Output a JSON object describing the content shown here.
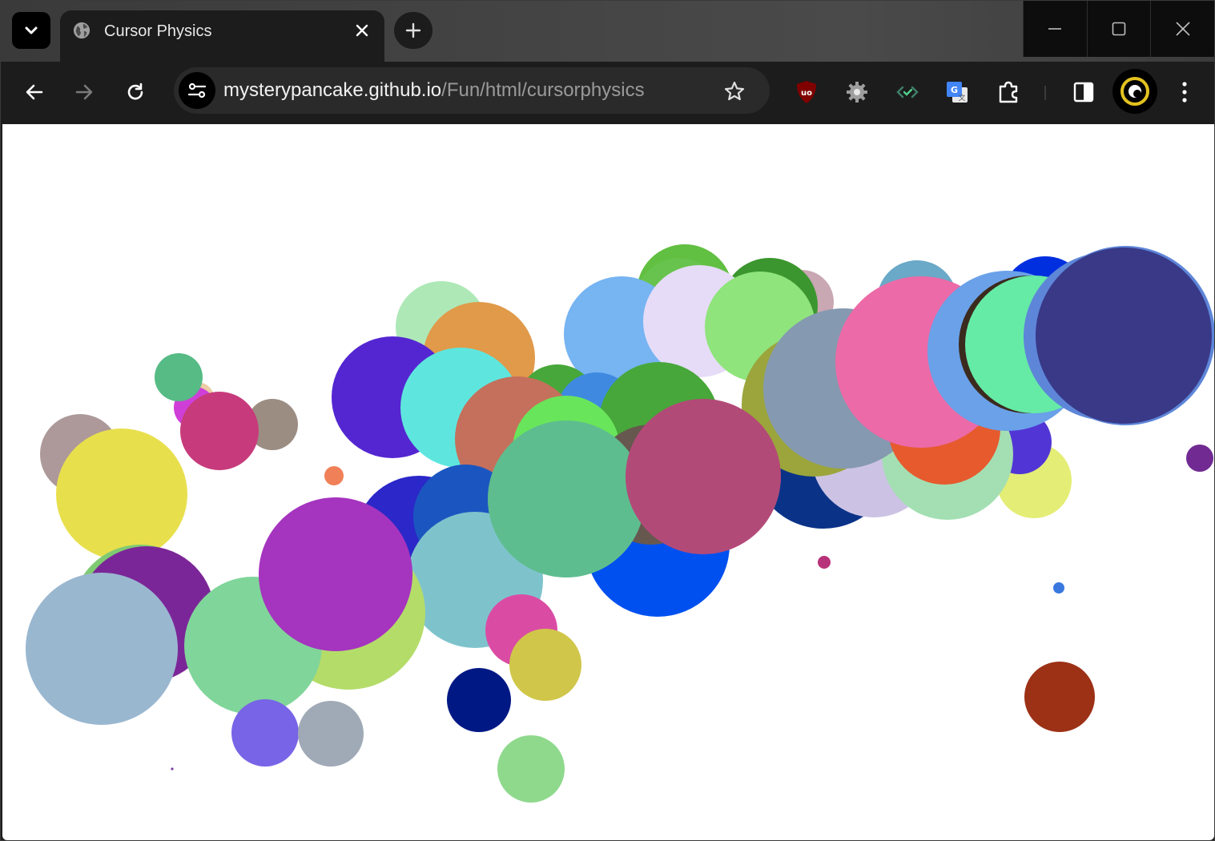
{
  "browser": {
    "tab": {
      "title": "Cursor Physics",
      "favicon": "globe-icon",
      "close_icon": "close-icon"
    },
    "buttons": {
      "tab_search": "chevron-down-icon",
      "new_tab": "plus-icon",
      "back": "back-arrow-icon",
      "forward": "forward-arrow-icon",
      "reload": "reload-icon",
      "bookmark": "star-icon",
      "menu": "kebab-menu-icon"
    },
    "window_controls": [
      "minimize-icon",
      "maximize-icon",
      "close-icon"
    ],
    "address": {
      "host": "mysterypancake.github.io",
      "path": "/Fun/html/cursorphysics",
      "site_info_icon": "tune-icon"
    },
    "extensions": [
      "ublock-origin-icon",
      "gear-extension-icon",
      "code-check-icon",
      "google-translate-icon",
      "extensions-puzzle-icon",
      "side-panel-icon"
    ],
    "profile_icon": "profile-avatar-icon"
  },
  "page": {
    "background": "#ffffff",
    "shape": "circle",
    "colors": [
      "#61bf41",
      "#2fa84f",
      "#68c34e",
      "#c9a7b3",
      "#3c962f",
      "#6aa9c7",
      "#cf3fd8",
      "#0050f0",
      "#eccca5",
      "#56bb85",
      "#aee8b7",
      "#e09a4a",
      "#c73b7c",
      "#9c8d83",
      "#5426d1",
      "#5ee6de",
      "#76b4f2",
      "#e6dcf7",
      "#8fe47b",
      "#47a73a",
      "#3f8ae0",
      "#c5705c",
      "#69e55b",
      "#67584f",
      "#5ebd8f",
      "#b24a78",
      "#ad9999",
      "#e8df4d",
      "#f08058",
      "#2b27c8",
      "#1b56c0",
      "#7ec3cc",
      "#a534bf",
      "#b4dc69",
      "#7b2698",
      "#80d59a",
      "#7fca72",
      "#9ab7d0",
      "#da4ca4",
      "#d0c64a",
      "#001884",
      "#8fd98d",
      "#7864e6",
      "#a0aab7",
      "#e4ed75",
      "#5136d5",
      "#0a3388",
      "#ccc3e4",
      "#a3dfb2",
      "#9ba53b",
      "#e65a2e",
      "#8599b0",
      "#ec6aa7",
      "#6aa1e9",
      "#002fe0",
      "#3b2a1e",
      "#65eba6",
      "#5e86d8",
      "#393988",
      "#702a92",
      "#b8327a",
      "#3a78e0",
      "#9c3116",
      "#7b3ca0"
    ]
  }
}
